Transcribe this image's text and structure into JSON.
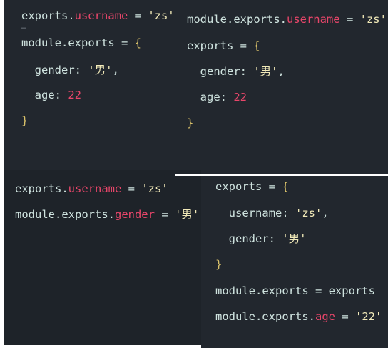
{
  "panel_a": {
    "lines": [
      [
        [
          "plain",
          "exports."
        ],
        [
          "prop",
          "username"
        ],
        [
          "plain",
          " = "
        ],
        [
          "str",
          "'zs'"
        ]
      ],
      [
        [
          "plain",
          "module.exports = "
        ],
        [
          "brace",
          "{"
        ]
      ],
      [
        [
          "plain",
          "  gender: "
        ],
        [
          "str",
          "'男'"
        ],
        [
          "plain",
          ","
        ]
      ],
      [
        [
          "plain",
          "  age: "
        ],
        [
          "num",
          "22"
        ]
      ],
      [
        [
          "brace",
          "}"
        ]
      ]
    ],
    "fold_marker": "…"
  },
  "panel_b": {
    "lines": [
      [
        [
          "plain",
          "module.exports."
        ],
        [
          "prop",
          "username"
        ],
        [
          "plain",
          " = "
        ],
        [
          "str",
          "'zs'"
        ]
      ],
      [
        [
          "plain",
          "exports = "
        ],
        [
          "brace",
          "{"
        ]
      ],
      [
        [
          "plain",
          "  gender: "
        ],
        [
          "str",
          "'男'"
        ],
        [
          "plain",
          ","
        ]
      ],
      [
        [
          "plain",
          "  age: "
        ],
        [
          "num",
          "22"
        ]
      ],
      [
        [
          "brace",
          "}"
        ]
      ]
    ]
  },
  "panel_c": {
    "lines": [
      [
        [
          "plain",
          "exports."
        ],
        [
          "prop",
          "username"
        ],
        [
          "plain",
          " = "
        ],
        [
          "str",
          "'zs'"
        ]
      ],
      [
        [
          "plain",
          "module.exports."
        ],
        [
          "prop",
          "gender"
        ],
        [
          "plain",
          " = "
        ],
        [
          "str",
          "'男'"
        ]
      ]
    ]
  },
  "panel_d": {
    "lines": [
      [
        [
          "plain",
          "exports = "
        ],
        [
          "brace",
          "{"
        ]
      ],
      [
        [
          "plain",
          "  username: "
        ],
        [
          "str",
          "'zs'"
        ],
        [
          "plain",
          ","
        ]
      ],
      [
        [
          "plain",
          "  gender: "
        ],
        [
          "str",
          "'男'"
        ]
      ],
      [
        [
          "brace",
          "}"
        ]
      ],
      [
        [
          "plain",
          "module.exports = exports"
        ]
      ],
      [
        [
          "plain",
          "module.exports."
        ],
        [
          "prop",
          "age"
        ],
        [
          "plain",
          " = "
        ],
        [
          "str",
          "'22'"
        ]
      ]
    ]
  },
  "colors": {
    "background": "#22272e",
    "text": "#cfe3df",
    "property": "#e8466a",
    "string": "#f1e9b8",
    "number": "#e8466a",
    "brace": "#d9c16a"
  }
}
